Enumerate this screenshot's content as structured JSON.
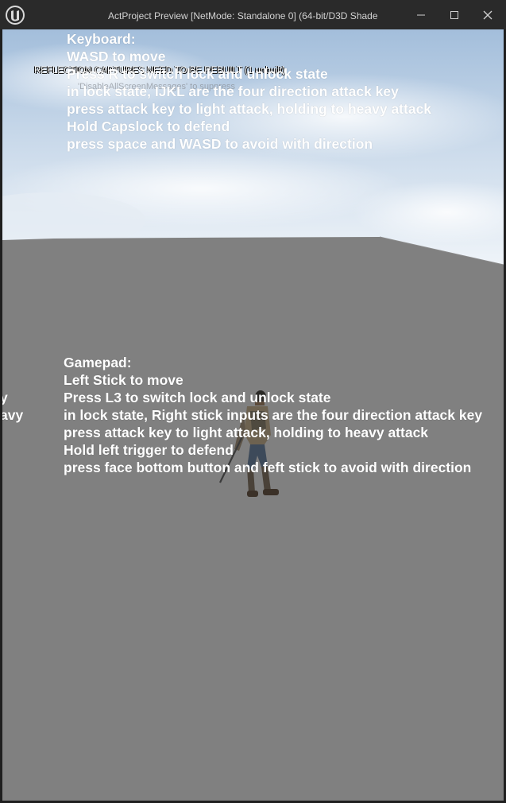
{
  "window": {
    "title": "ActProject Preview [NetMode: Standalone 0]  (64-bit/D3D Shade",
    "logo_icon": "unreal-engine-logo",
    "controls": [
      "minimize-icon",
      "maximize-icon",
      "close-icon"
    ]
  },
  "viewport": {
    "warning": "REFLECTION CAPTURES NEED TO BE REBUILT (1 unbuilt)",
    "warning_sub": "'DisableAllScreenMessages' to suppress",
    "keyboard_help": [
      "Keyboard:",
      "WASD to move",
      "Press R to switch lock and unlock state",
      "in lock state, IJKL are the four direction attack key",
      "press attack key to light attack, holding to heavy attack",
      "Hold Capslock to defend",
      "press space and WASD to avoid with direction"
    ],
    "gamepad_help": [
      "Gamepad:",
      "Left Stick to move",
      "Press L3 to switch lock and unlock state",
      "in lock state, Right stick inputs are the four direction attack key",
      "press attack key to light attack, holding to heavy attack",
      "Hold left trigger to defend",
      "press face bottom button and feft stick to avoid with direction"
    ],
    "left_fragments": [
      "y",
      "avy"
    ],
    "colors": {
      "floor": "#808080",
      "sky_top": "#a9c3df",
      "sky_bottom": "#eef3f8",
      "text": "#ffffff"
    }
  }
}
